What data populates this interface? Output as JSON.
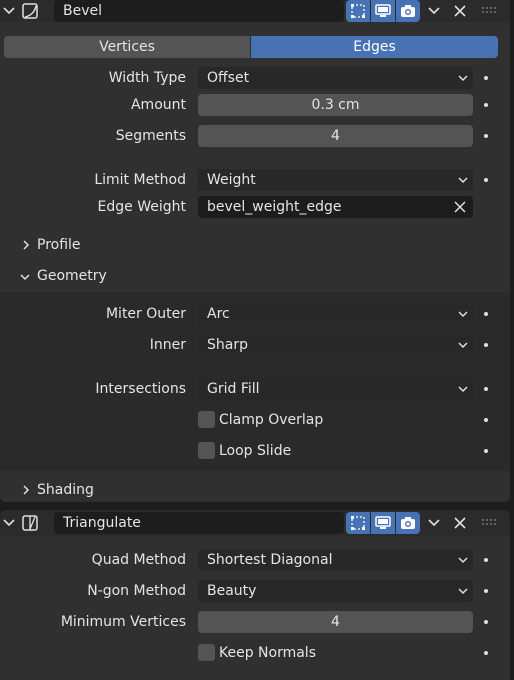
{
  "bevel": {
    "name": "Bevel",
    "mode_tabs": [
      "Vertices",
      "Edges"
    ],
    "active_tab": "Edges",
    "width_type": {
      "label": "Width Type",
      "value": "Offset"
    },
    "amount": {
      "label": "Amount",
      "value": "0.3 cm"
    },
    "segments": {
      "label": "Segments",
      "value": "4"
    },
    "limit_method": {
      "label": "Limit Method",
      "value": "Weight"
    },
    "edge_weight": {
      "label": "Edge Weight",
      "value": "bevel_weight_edge"
    },
    "profile": "Profile",
    "geometry": {
      "header": "Geometry",
      "miter_outer": {
        "label": "Miter Outer",
        "value": "Arc"
      },
      "inner": {
        "label": "Inner",
        "value": "Sharp"
      },
      "intersections": {
        "label": "Intersections",
        "value": "Grid Fill"
      },
      "clamp_overlap": {
        "label": "Clamp Overlap",
        "checked": false
      },
      "loop_slide": {
        "label": "Loop Slide",
        "checked": false
      }
    },
    "shading": "Shading"
  },
  "triangulate": {
    "name": "Triangulate",
    "quad_method": {
      "label": "Quad Method",
      "value": "Shortest Diagonal"
    },
    "ngon_method": {
      "label": "N-gon Method",
      "value": "Beauty"
    },
    "min_vertices": {
      "label": "Minimum Vertices",
      "value": "4"
    },
    "keep_normals": {
      "label": "Keep Normals",
      "checked": false
    }
  },
  "icons": {
    "collapse": "chevron-down-icon",
    "bevel_modifier": "bevel-modifier-icon",
    "triangulate_modifier": "triangulate-modifier-icon",
    "edit_mode": "edit-mode-icon",
    "viewport": "monitor-icon",
    "render": "camera-icon",
    "menu": "chevron-down-icon",
    "remove": "close-icon",
    "drag": "drag-grip-icon",
    "animate": "dot-icon"
  },
  "colors": {
    "accent": "#4772b3",
    "panel": "#303030",
    "header": "#2b2b2b",
    "field": "#545454",
    "dropdown": "#282828",
    "text": "#e5e5e5"
  }
}
